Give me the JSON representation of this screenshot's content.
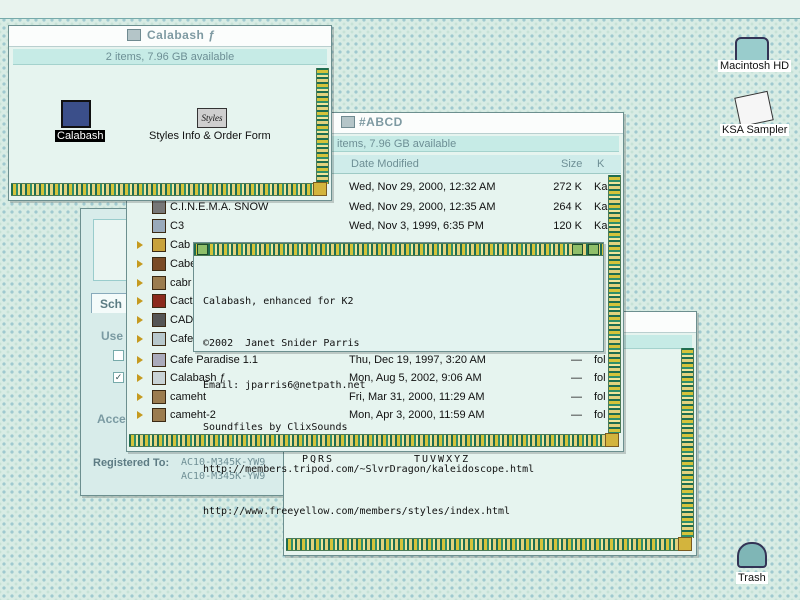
{
  "desktop": {
    "icons": [
      {
        "label": "Macintosh HD",
        "icon": "hard-disk-icon"
      },
      {
        "label": "KSA Sampler",
        "icon": "document-icon"
      },
      {
        "label": "Trash",
        "icon": "trash-icon"
      }
    ]
  },
  "calabash_window": {
    "title": "Calabash ƒ",
    "info": "2 items, 7.96 GB available",
    "items": [
      {
        "label": "Calabash",
        "icon": "application-icon",
        "selected": true
      },
      {
        "label": "Styles Info & Order Form",
        "icon": "styles-document-icon",
        "icon_text": "Styles"
      }
    ]
  },
  "abcd_window": {
    "title": "#ABCD",
    "info": "items, 7.96 GB available",
    "columns": {
      "date": "Date Modified",
      "size": "Size",
      "kind": "K"
    },
    "rows": [
      {
        "name": "",
        "date": "Wed, Nov 29, 2000, 12:32 AM",
        "size": "272 K",
        "kind": "Ka"
      },
      {
        "name": "C.I.N.E.M.A. SNOW",
        "date": "Wed, Nov 29, 2000, 12:35 AM",
        "size": "264 K",
        "kind": "Ka"
      },
      {
        "name": "C3",
        "date": "Wed, Nov 3, 1999, 6:35 PM",
        "size": "120 K",
        "kind": "Ka"
      },
      {
        "name": "Cab",
        "date": "",
        "size": "",
        "kind": ""
      },
      {
        "name": "Cabe",
        "date": "",
        "size": "",
        "kind": ""
      },
      {
        "name": "cabr",
        "date": "",
        "size": "",
        "kind": ""
      },
      {
        "name": "Cact",
        "date": "",
        "size": "",
        "kind": ""
      },
      {
        "name": "CADU",
        "date": "",
        "size": "",
        "kind": ""
      },
      {
        "name": "Cafe",
        "date": "",
        "size": "",
        "kind": ""
      },
      {
        "name": "Cafe Paradise 1.1",
        "date": "Thu, Dec 19, 1997, 3:20 AM",
        "size": "—",
        "kind": "fol"
      },
      {
        "name": "Calabash ƒ",
        "date": "Mon, Aug 5, 2002, 9:06 AM",
        "size": "—",
        "kind": "fol"
      },
      {
        "name": "cameht",
        "date": "Fri, Mar 31, 2000, 11:29 AM",
        "size": "—",
        "kind": "fol"
      },
      {
        "name": "cameht-2",
        "date": "Mon, Apr 3, 2000, 11:59 AM",
        "size": "—",
        "kind": "fol"
      }
    ]
  },
  "about_popup": {
    "lines": [
      "Calabash, enhanced for K2",
      "©2002  Janet Snider Parris",
      "Email: jparris6@netpath.net",
      "Soundfiles by ClixSounds",
      "http://members.tripod.com/~SlvrDragon/kaleidoscope.html",
      "http://www.freeyellow.com/members/styles/index.html"
    ]
  },
  "back_panel": {
    "tab": "Sch",
    "use_label": "Use",
    "access_label": "Acce",
    "registered_label": "Registered To:",
    "registered_values": [
      "AC10-M345K-YW9",
      "AC10-M345K-YW9"
    ]
  },
  "letters_window": {
    "letters_left": "PQRS",
    "letters_right": "TUVWXYZ"
  }
}
